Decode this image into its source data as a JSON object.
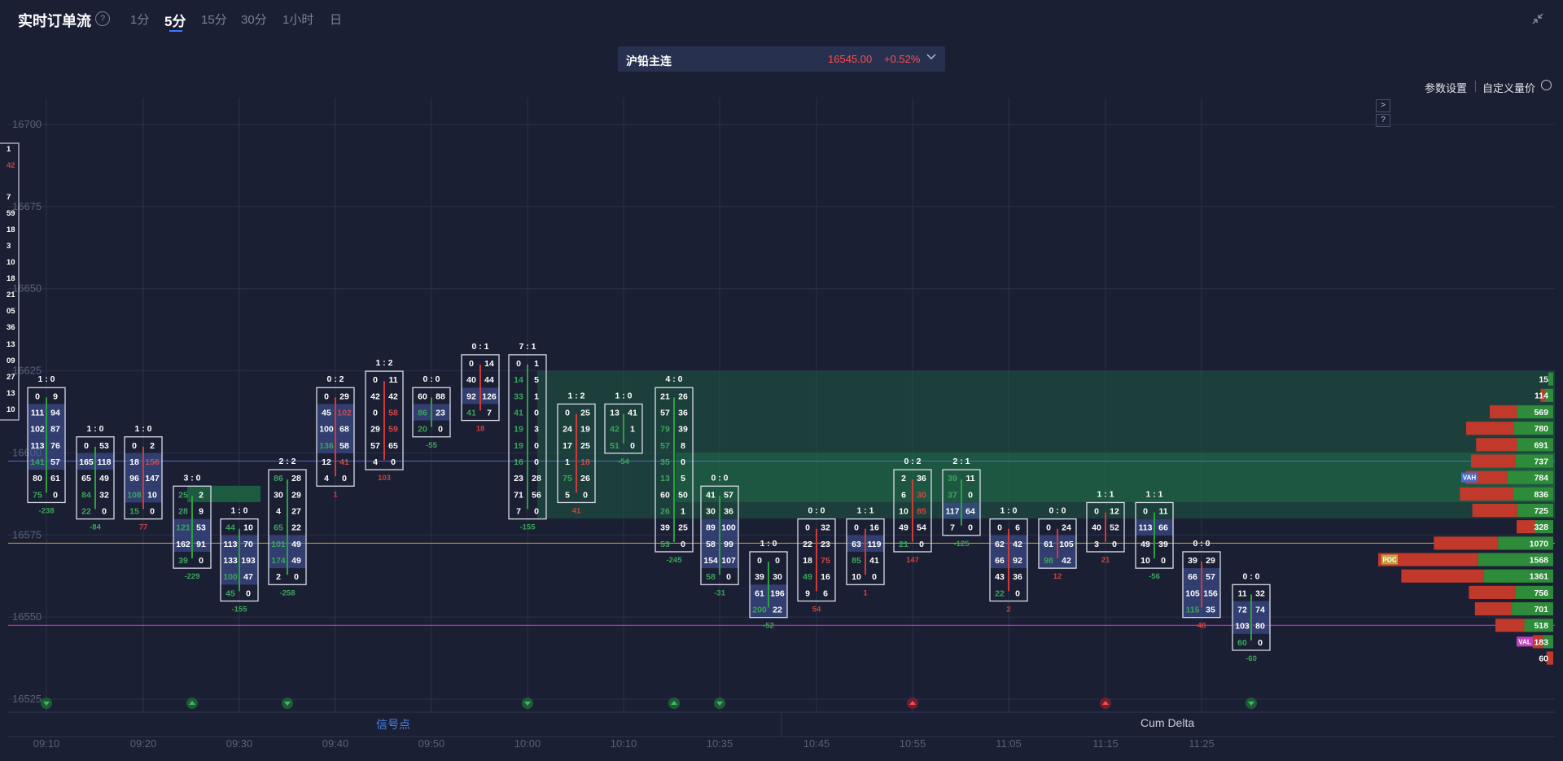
{
  "header": {
    "title": "实时订单流",
    "help": "?",
    "timeframes": [
      "1分",
      "5分",
      "15分",
      "30分",
      "1小时",
      "日"
    ],
    "active_timeframe": "5分"
  },
  "symbol": {
    "name": "沪铅主连",
    "price": "16545.00",
    "change": "+0.52%"
  },
  "settings": {
    "params": "参数设置",
    "custom": "自定义量价"
  },
  "side_buttons": [
    ">",
    "?"
  ],
  "bottom_tabs": {
    "signal": "信号点",
    "cum_delta": "Cum Delta"
  },
  "colors": {
    "background": "#1b1f33",
    "buy": "#2ea043",
    "sell": "#d03a3a",
    "highlight": "#4a5fa0",
    "val": "#c040c0",
    "poc": "#c8a040"
  },
  "chart_data": {
    "type": "footprint",
    "y_ticks": [
      16700,
      16675,
      16650,
      16625,
      16600,
      16575,
      16550,
      16525
    ],
    "ylim": [
      16522,
      16705
    ],
    "price_step": 5,
    "reference_lines": {
      "vah": 16600,
      "poc": 16575,
      "val": 16550
    },
    "x_ticks": [
      "09:10",
      "09:20",
      "09:30",
      "09:40",
      "09:50",
      "10:00",
      "10:10",
      "10:35",
      "10:45",
      "10:55",
      "11:05",
      "11:15",
      "11:25"
    ],
    "bars": [
      {
        "ratio": "1 : 0",
        "top": 16620,
        "delta": -238,
        "rows": [
          [
            0,
            9
          ],
          [
            111,
            94
          ],
          [
            102,
            87
          ],
          [
            113,
            76
          ],
          [
            141,
            57
          ],
          [
            80,
            61
          ],
          [
            75,
            0
          ]
        ]
      },
      {
        "ratio": "1 : 0",
        "top": 16605,
        "delta": -84,
        "rows": [
          [
            0,
            53
          ],
          [
            165,
            118
          ],
          [
            65,
            49
          ],
          [
            84,
            32
          ],
          [
            22,
            0
          ]
        ]
      },
      {
        "ratio": "1 : 0",
        "top": 16605,
        "delta": 77,
        "rows": [
          [
            0,
            2
          ],
          [
            18,
            156
          ],
          [
            96,
            147
          ],
          [
            108,
            10
          ],
          [
            15,
            0
          ]
        ]
      },
      {
        "ratio": "3 : 0",
        "top": 16590,
        "delta": -229,
        "rows": [
          [
            25,
            2
          ],
          [
            28,
            9
          ],
          [
            121,
            53
          ],
          [
            162,
            91
          ],
          [
            39,
            0
          ]
        ]
      },
      {
        "ratio": "1 : 0",
        "top": 16580,
        "delta": -155,
        "rows": [
          [
            44,
            10
          ],
          [
            113,
            70
          ],
          [
            133,
            193
          ],
          [
            100,
            47
          ],
          [
            45,
            0
          ]
        ]
      },
      {
        "ratio": "2 : 2",
        "top": 16595,
        "delta": -258,
        "rows": [
          [
            86,
            28
          ],
          [
            30,
            29
          ],
          [
            4,
            27
          ],
          [
            65,
            22
          ],
          [
            101,
            49
          ],
          [
            174,
            49
          ],
          [
            2,
            0
          ]
        ]
      },
      {
        "ratio": "0 : 2",
        "top": 16620,
        "delta": 1,
        "rows": [
          [
            0,
            29
          ],
          [
            45,
            102
          ],
          [
            100,
            68
          ],
          [
            136,
            58
          ],
          [
            12,
            41
          ],
          [
            4,
            0
          ]
        ]
      },
      {
        "ratio": "1 : 2",
        "top": 16625,
        "delta": 103,
        "rows": [
          [
            0,
            11
          ],
          [
            42,
            42
          ],
          [
            0,
            58
          ],
          [
            29,
            59
          ],
          [
            57,
            65
          ],
          [
            4,
            0
          ]
        ]
      },
      {
        "ratio": "0 : 0",
        "top": 16620,
        "delta": -55,
        "rows": [
          [
            60,
            88
          ],
          [
            86,
            23
          ],
          [
            20,
            0
          ]
        ]
      },
      {
        "ratio": "0 : 1",
        "top": 16630,
        "delta": 18,
        "rows": [
          [
            0,
            14
          ],
          [
            40,
            44
          ],
          [
            92,
            126
          ],
          [
            41,
            7
          ]
        ]
      },
      {
        "ratio": "7 : 1",
        "top": 16630,
        "delta": -155,
        "rows": [
          [
            0,
            1
          ],
          [
            14,
            5
          ],
          [
            33,
            1
          ],
          [
            41,
            0
          ],
          [
            19,
            3
          ],
          [
            19,
            0
          ],
          [
            16,
            0
          ],
          [
            23,
            28
          ],
          [
            71,
            56
          ],
          [
            7,
            0
          ]
        ]
      },
      {
        "ratio": "1 : 2",
        "top": 16615,
        "delta": 41,
        "rows": [
          [
            0,
            25
          ],
          [
            24,
            19
          ],
          [
            17,
            25
          ],
          [
            1,
            18
          ],
          [
            75,
            26
          ],
          [
            5,
            0
          ]
        ]
      },
      {
        "ratio": "1 : 0",
        "top": 16615,
        "delta": -54,
        "rows": [
          [
            13,
            41
          ],
          [
            42,
            1
          ],
          [
            51,
            0
          ]
        ]
      },
      {
        "ratio": "4 : 0",
        "top": 16620,
        "delta": -245,
        "rows": [
          [
            21,
            26
          ],
          [
            57,
            36
          ],
          [
            79,
            39
          ],
          [
            57,
            8
          ],
          [
            35,
            0
          ],
          [
            13,
            5
          ],
          [
            60,
            50
          ],
          [
            26,
            1
          ],
          [
            39,
            25
          ],
          [
            53,
            0
          ]
        ]
      },
      {
        "ratio": "0 : 0",
        "top": 16590,
        "delta": -31,
        "rows": [
          [
            41,
            57
          ],
          [
            30,
            36
          ],
          [
            89,
            100
          ],
          [
            58,
            99
          ],
          [
            154,
            107
          ],
          [
            58,
            0
          ]
        ]
      },
      {
        "ratio": "1 : 0",
        "top": 16570,
        "delta": -52,
        "rows": [
          [
            0,
            0
          ],
          [
            39,
            30
          ],
          [
            61,
            196
          ],
          [
            200,
            22
          ]
        ]
      },
      {
        "ratio": "0 : 0",
        "top": 16580,
        "delta": 54,
        "rows": [
          [
            0,
            32
          ],
          [
            22,
            23
          ],
          [
            18,
            75
          ],
          [
            49,
            16
          ],
          [
            9,
            6
          ]
        ]
      },
      {
        "ratio": "1 : 1",
        "top": 16580,
        "delta": 1,
        "rows": [
          [
            0,
            16
          ],
          [
            63,
            119
          ],
          [
            85,
            41
          ],
          [
            10,
            0
          ]
        ]
      },
      {
        "ratio": "0 : 2",
        "top": 16595,
        "delta": 147,
        "rows": [
          [
            2,
            36
          ],
          [
            6,
            30
          ],
          [
            10,
            85
          ],
          [
            49,
            54
          ],
          [
            21,
            0
          ]
        ]
      },
      {
        "ratio": "2 : 1",
        "top": 16595,
        "delta": -125,
        "rows": [
          [
            39,
            11
          ],
          [
            37,
            0
          ],
          [
            117,
            64
          ],
          [
            7,
            0
          ]
        ]
      },
      {
        "ratio": "1 : 0",
        "top": 16580,
        "delta": 2,
        "rows": [
          [
            0,
            6
          ],
          [
            62,
            42
          ],
          [
            66,
            92
          ],
          [
            43,
            36
          ],
          [
            22,
            0
          ]
        ]
      },
      {
        "ratio": "0 : 0",
        "top": 16580,
        "delta": 12,
        "rows": [
          [
            0,
            24
          ],
          [
            61,
            105
          ],
          [
            98,
            42
          ]
        ]
      },
      {
        "ratio": "1 : 1",
        "top": 16585,
        "delta": 21,
        "rows": [
          [
            0,
            12
          ],
          [
            40,
            52
          ],
          [
            3,
            0
          ]
        ]
      },
      {
        "ratio": "1 : 1",
        "top": 16585,
        "delta": -56,
        "rows": [
          [
            0,
            11
          ],
          [
            113,
            66
          ],
          [
            49,
            39
          ],
          [
            10,
            0
          ]
        ]
      },
      {
        "ratio": "0 : 0",
        "top": 16570,
        "delta": 48,
        "rows": [
          [
            39,
            29
          ],
          [
            66,
            57
          ],
          [
            105,
            156
          ],
          [
            115,
            35
          ]
        ]
      },
      {
        "ratio": "0 : 0",
        "top": 16560,
        "delta": -60,
        "rows": [
          [
            11,
            32
          ],
          [
            72,
            74
          ],
          [
            103,
            80
          ],
          [
            60,
            0
          ]
        ]
      }
    ],
    "partial_left_column": [
      "1",
      "42",
      "7",
      "59",
      "18",
      "3",
      "10",
      "18",
      "21",
      "05",
      "36",
      "13",
      "09",
      "27",
      "13",
      "10"
    ],
    "volume_profile": [
      {
        "price": 16625,
        "total": 15,
        "buy": 1,
        "sell": 0
      },
      {
        "price": 16620,
        "total": 114,
        "buy": 20,
        "sell": 10
      },
      {
        "price": 16615,
        "total": 569,
        "buy": 40,
        "sell": 30
      },
      {
        "price": 16610,
        "total": 780,
        "buy": 45,
        "sell": 55
      },
      {
        "price": 16605,
        "total": 691,
        "buy": 40,
        "sell": 45
      },
      {
        "price": 16600,
        "total": 737,
        "buy": 42,
        "sell": 50
      },
      {
        "price": 16595,
        "total": 784,
        "buy": 55,
        "sell": 50
      },
      {
        "price": 16590,
        "total": 836,
        "buy": 45,
        "sell": 60
      },
      {
        "price": 16585,
        "total": 725,
        "buy": 40,
        "sell": 50
      },
      {
        "price": 16580,
        "total": 328,
        "buy": 15,
        "sell": 15
      },
      {
        "price": 16575,
        "total": 1070,
        "buy": 60,
        "sell": 70
      },
      {
        "price": 16570,
        "total": 1568,
        "buy": 90,
        "sell": 120
      },
      {
        "price": 16565,
        "total": 1361,
        "buy": 80,
        "sell": 95
      },
      {
        "price": 16560,
        "total": 756,
        "buy": 45,
        "sell": 55
      },
      {
        "price": 16555,
        "total": 701,
        "buy": 45,
        "sell": 40
      },
      {
        "price": 16550,
        "total": 518,
        "buy": 30,
        "sell": 30
      },
      {
        "price": 16545,
        "total": 183,
        "buy": 10,
        "sell": 10
      },
      {
        "price": 16540,
        "total": 60,
        "buy": 0,
        "sell": 5
      }
    ],
    "profile_markers": {
      "vah": "VAH",
      "poc": "POC",
      "val": "VAL"
    },
    "signals": [
      {
        "bar": 0,
        "dir": "down"
      },
      {
        "bar": 3,
        "dir": "up"
      },
      {
        "bar": 5,
        "dir": "down"
      },
      {
        "bar": 10,
        "dir": "down"
      },
      {
        "bar": 13,
        "dir": "up"
      },
      {
        "bar": 14,
        "dir": "down"
      },
      {
        "bar": 18,
        "dir": "up-red"
      },
      {
        "bar": 22,
        "dir": "up-red"
      },
      {
        "bar": 25,
        "dir": "down"
      }
    ]
  }
}
